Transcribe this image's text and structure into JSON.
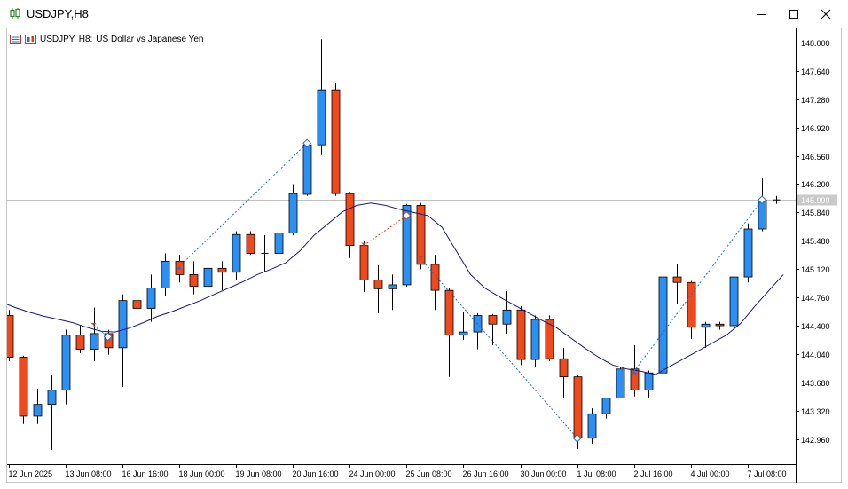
{
  "window": {
    "title": "USDJPY,H8",
    "header_symbol": "USDJPY, H8:",
    "header_desc": "US Dollar vs Japanese Yen"
  },
  "colors": {
    "bull": "#2b8ff3",
    "bear": "#f0491b",
    "ma": "#16168a",
    "wick": "#000000",
    "trade_win": "#1f6fd0",
    "trade_loss": "#e23a0f",
    "price_line": "#c0c0c0"
  },
  "icons": {
    "title": "chart-candles-icon",
    "minimize": "minimize-icon",
    "maximize": "maximize-icon",
    "close": "close-icon",
    "header_a": "properties-icon",
    "header_b": "chart-type-icon"
  },
  "chart_data": {
    "type": "candlestick",
    "symbol": "USDJPY",
    "timeframe": "H8",
    "ylim": [
      142.64,
      148.18
    ],
    "y_ticks": [
      "148.000",
      "147.640",
      "147.280",
      "146.920",
      "146.560",
      "146.200",
      "145.840",
      "145.480",
      "145.120",
      "144.760",
      "144.400",
      "144.040",
      "143.680",
      "143.320",
      "142.960"
    ],
    "current_price": "145.999",
    "x_tick_labels": [
      {
        "bar": 0,
        "label": "12 Jun 2025"
      },
      {
        "bar": 4,
        "label": "13 Jun 08:00"
      },
      {
        "bar": 8,
        "label": "16 Jun 16:00"
      },
      {
        "bar": 12,
        "label": "18 Jun 00:00"
      },
      {
        "bar": 16,
        "label": "19 Jun 08:00"
      },
      {
        "bar": 20,
        "label": "20 Jun 16:00"
      },
      {
        "bar": 24,
        "label": "24 Jun 00:00"
      },
      {
        "bar": 28,
        "label": "25 Jun 08:00"
      },
      {
        "bar": 32,
        "label": "26 Jun 16:00"
      },
      {
        "bar": 36,
        "label": "30 Jun 00:00"
      },
      {
        "bar": 40,
        "label": "1 Jul 08:00"
      },
      {
        "bar": 44,
        "label": "2 Jul 16:00"
      },
      {
        "bar": 48,
        "label": "4 Jul 00:00"
      },
      {
        "bar": 52,
        "label": "7 Jul 08:00"
      }
    ],
    "candles": [
      [
        144.53,
        144.6,
        143.95,
        144.0
      ],
      [
        144.0,
        144.02,
        143.15,
        143.25
      ],
      [
        143.25,
        143.6,
        143.15,
        143.4
      ],
      [
        143.4,
        143.77,
        142.82,
        143.58
      ],
      [
        143.58,
        144.35,
        143.4,
        144.28
      ],
      [
        144.28,
        144.4,
        144.05,
        144.1
      ],
      [
        144.1,
        144.63,
        143.95,
        144.3
      ],
      [
        144.3,
        144.35,
        144.03,
        144.12
      ],
      [
        144.12,
        144.8,
        143.62,
        144.72
      ],
      [
        144.72,
        145.0,
        144.48,
        144.62
      ],
      [
        144.62,
        145.05,
        144.45,
        144.88
      ],
      [
        144.88,
        145.32,
        144.78,
        145.22
      ],
      [
        145.22,
        145.3,
        144.95,
        145.05
      ],
      [
        145.05,
        145.22,
        144.8,
        144.9
      ],
      [
        144.9,
        145.3,
        144.32,
        145.13
      ],
      [
        145.13,
        145.22,
        144.85,
        145.08
      ],
      [
        145.08,
        145.6,
        144.98,
        145.56
      ],
      [
        145.56,
        145.6,
        145.3,
        145.32
      ],
      [
        145.32,
        145.55,
        145.08,
        145.32
      ],
      [
        145.32,
        145.62,
        145.3,
        145.58
      ],
      [
        145.58,
        146.2,
        145.55,
        146.08
      ],
      [
        146.07,
        146.75,
        146.05,
        146.7
      ],
      [
        146.7,
        148.04,
        146.57,
        147.4
      ],
      [
        147.4,
        147.48,
        146.05,
        146.08
      ],
      [
        146.08,
        146.1,
        145.26,
        145.42
      ],
      [
        145.42,
        145.47,
        144.83,
        144.98
      ],
      [
        144.98,
        145.17,
        144.56,
        144.87
      ],
      [
        144.87,
        145.05,
        144.6,
        144.92
      ],
      [
        144.92,
        145.95,
        144.9,
        145.93
      ],
      [
        145.93,
        145.96,
        145.12,
        145.18
      ],
      [
        145.18,
        145.3,
        144.6,
        144.85
      ],
      [
        144.85,
        144.88,
        143.75,
        144.28
      ],
      [
        144.28,
        144.58,
        144.22,
        144.32
      ],
      [
        144.32,
        144.56,
        144.1,
        144.53
      ],
      [
        144.53,
        144.55,
        144.15,
        144.42
      ],
      [
        144.42,
        144.84,
        144.3,
        144.6
      ],
      [
        144.6,
        144.65,
        143.9,
        143.97
      ],
      [
        143.97,
        144.53,
        143.88,
        144.48
      ],
      [
        144.48,
        144.53,
        143.95,
        143.98
      ],
      [
        143.98,
        144.12,
        143.48,
        143.75
      ],
      [
        143.75,
        143.78,
        142.83,
        142.97
      ],
      [
        142.97,
        143.35,
        142.9,
        143.28
      ],
      [
        143.28,
        143.48,
        143.22,
        143.48
      ],
      [
        143.48,
        143.87,
        143.48,
        143.85
      ],
      [
        143.85,
        144.15,
        143.5,
        143.58
      ],
      [
        143.58,
        143.83,
        143.48,
        143.8
      ],
      [
        143.8,
        145.18,
        143.62,
        145.02
      ],
      [
        145.02,
        145.18,
        144.68,
        144.95
      ],
      [
        144.95,
        144.97,
        144.23,
        144.38
      ],
      [
        144.38,
        144.45,
        144.12,
        144.42
      ],
      [
        144.42,
        144.45,
        144.35,
        144.4
      ],
      [
        144.4,
        145.05,
        144.2,
        145.02
      ],
      [
        145.02,
        145.7,
        144.95,
        145.63
      ],
      [
        145.63,
        146.27,
        145.6,
        146.0
      ],
      [
        146.0,
        146.05,
        145.95,
        145.999
      ]
    ],
    "ma": [
      144.7,
      144.63,
      144.57,
      144.52,
      144.48,
      144.44,
      144.38,
      144.33,
      144.32,
      144.37,
      144.44,
      144.52,
      144.58,
      144.65,
      144.72,
      144.8,
      144.88,
      144.96,
      145.05,
      145.12,
      145.2,
      145.35,
      145.55,
      145.7,
      145.85,
      145.93,
      145.96,
      145.93,
      145.88,
      145.84,
      145.8,
      145.65,
      145.35,
      145.05,
      144.88,
      144.77,
      144.67,
      144.57,
      144.47,
      144.38,
      144.25,
      144.12,
      144.0,
      143.9,
      143.85,
      143.82,
      143.78,
      143.88,
      143.98,
      144.08,
      144.18,
      144.28,
      144.43,
      144.65,
      144.85,
      145.05
    ],
    "trades": [
      {
        "entry_bar": 6,
        "entry_price": 144.4,
        "exit_bar": 7,
        "exit_price": 144.26,
        "dir": "sell"
      },
      {
        "entry_bar": 12,
        "entry_price": 145.15,
        "exit_bar": 21,
        "exit_price": 146.72,
        "dir": "buy"
      },
      {
        "entry_bar": 25,
        "entry_price": 145.42,
        "exit_bar": 28,
        "exit_price": 145.8,
        "dir": "sell"
      },
      {
        "entry_bar": 29,
        "entry_price": 145.25,
        "exit_bar": 40,
        "exit_price": 142.97,
        "dir": "sell"
      },
      {
        "entry_bar": 44,
        "entry_price": 143.82,
        "exit_bar": 53,
        "exit_price": 146.0,
        "dir": "buy"
      }
    ]
  }
}
